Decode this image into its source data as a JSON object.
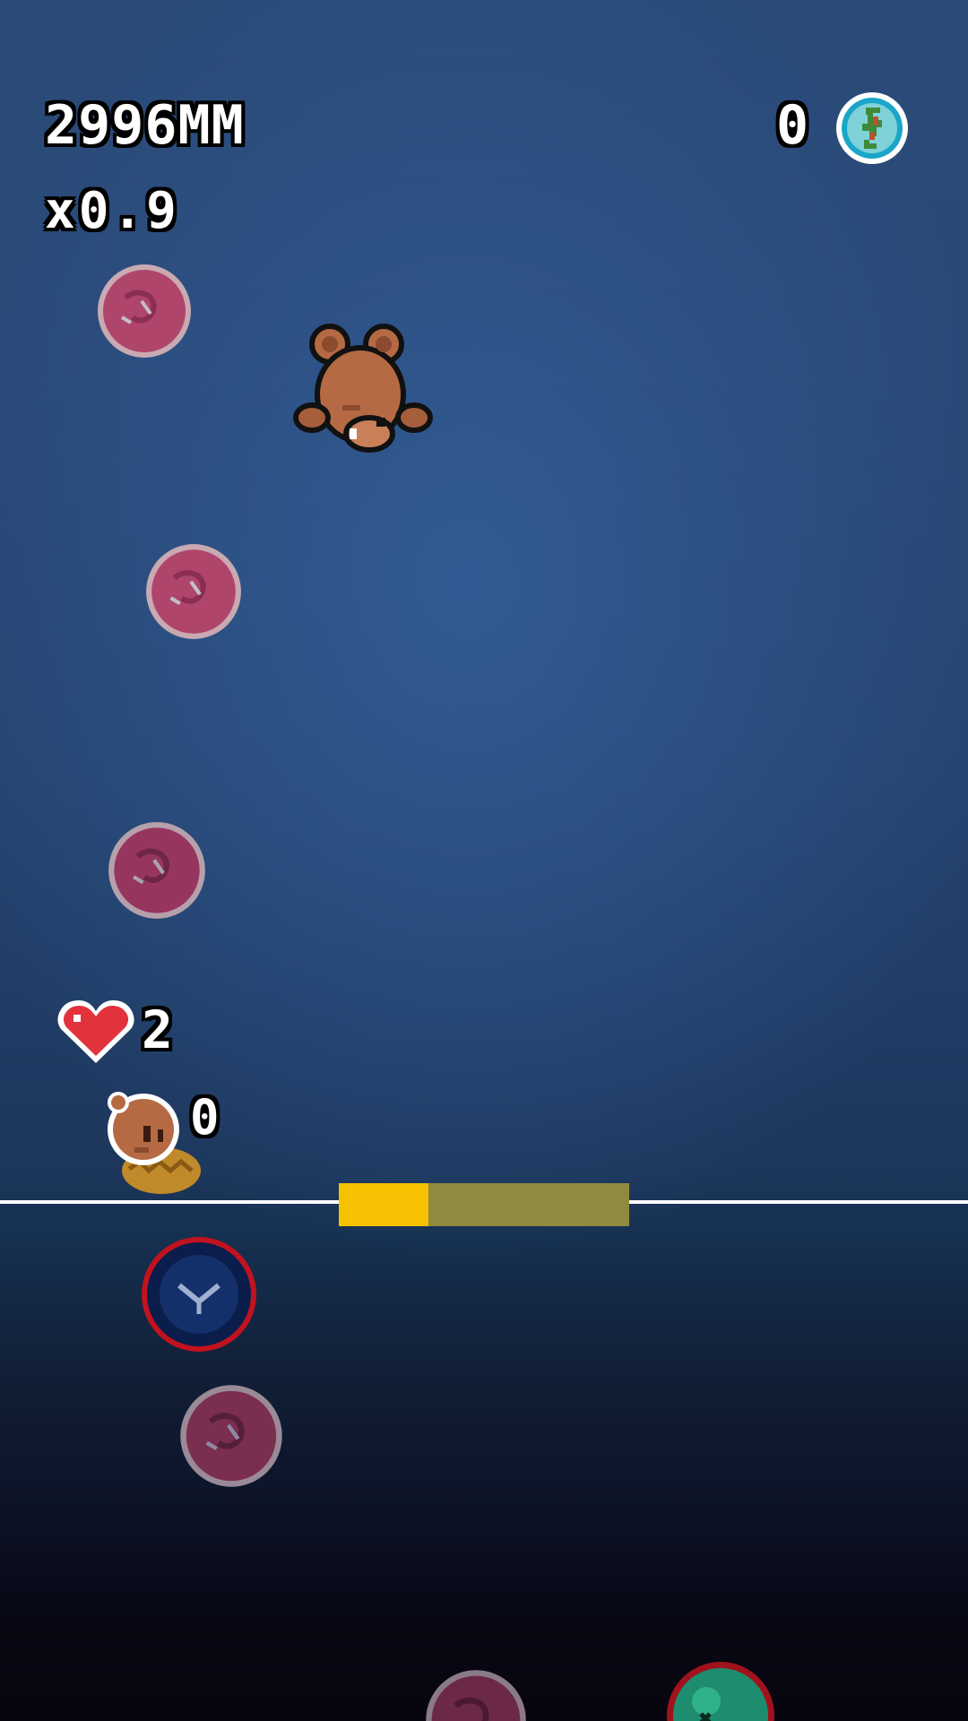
{
  "hud": {
    "distance": "2996MM",
    "multiplier": "x0.9",
    "coins": "0",
    "lives": "2",
    "rescued": "0"
  },
  "power_meter": {
    "fill_fraction": 0.31
  },
  "icons": {
    "coin": "globe-coin-icon",
    "lives": "heart-icon",
    "rescued": "bear-head-icon"
  },
  "colors": {
    "meter_fill": "#f6c100",
    "meter_track": "#8f8a3d",
    "depth_line": "#ffffff",
    "heart": "#e2333d"
  }
}
